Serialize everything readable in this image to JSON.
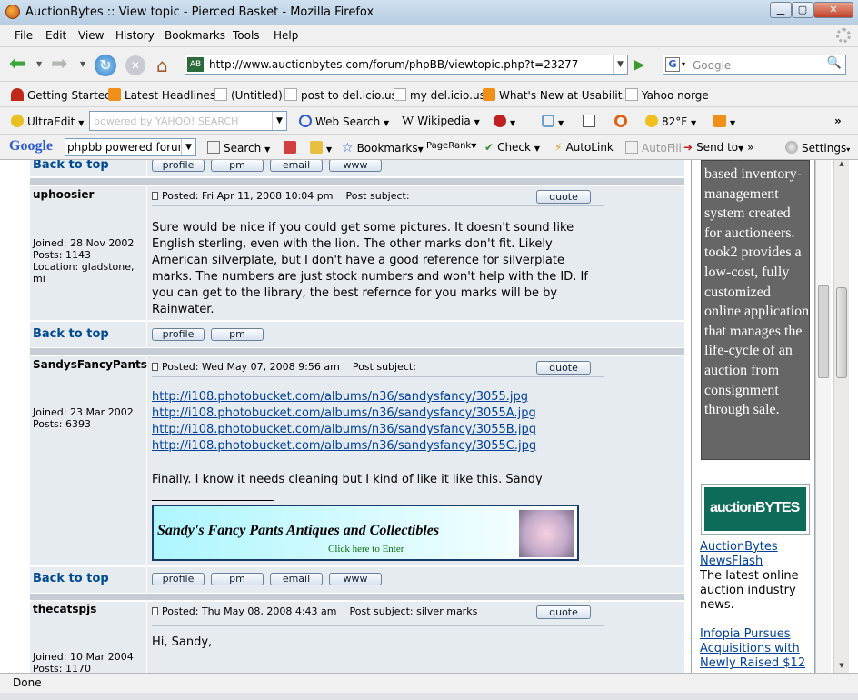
{
  "window": {
    "title": "AuctionBytes :: View topic - Pierced Basket - Mozilla Firefox"
  },
  "menu": [
    "File",
    "Edit",
    "View",
    "History",
    "Bookmarks",
    "Tools",
    "Help"
  ],
  "url": "http://www.auctionbytes.com/forum/phpBB/viewtopic.php?t=23277",
  "search": {
    "placeholder": "Google"
  },
  "bookmarks": [
    "Getting Started",
    "Latest Headlines",
    "(Untitled)",
    "post to del.icio.us",
    "my del.icio.us",
    "What's New at Usabilit...",
    "Yahoo norge"
  ],
  "toolbar": {
    "ultraedit": "UltraEdit",
    "yahoo_placeholder": "powered by YAHOO! SEARCH",
    "websearch": "Web Search",
    "wikipedia": "Wikipedia",
    "temp": "82°F"
  },
  "google_bar": {
    "logo": "Google",
    "query": "phpbb powered forum",
    "search": "Search",
    "bookmarks": "Bookmarks",
    "pagerank": "PageRank",
    "check": "Check",
    "autolink": "AutoLink",
    "autofill": "AutoFill",
    "sendto": "Send to",
    "settings": "Settings"
  },
  "forum": {
    "back_to_top": "Back to top",
    "btn_profile": "profile",
    "btn_pm": "pm",
    "btn_email": "email",
    "btn_www": "www",
    "btn_quote": "quote",
    "posts": [
      {
        "author": "uphoosier",
        "joined": "Joined: 28 Nov 2002",
        "posts": "Posts: 1143",
        "location": "Location: gladstone, mi",
        "posted": "Posted: Fri Apr 11, 2008 10:04 pm",
        "subject": "Post subject:",
        "body": "Sure would be nice if you could get some pictures. It doesn't sound like English sterling, even with the lion. The other marks don't fit. Likely American silverplate, but I don't have a good reference for silverplate marks. The numbers are just stock numbers and won't help with the ID. If you can get to the library, the best refernce for you marks will be by Rainwater."
      },
      {
        "author": "SandysFancyPants",
        "joined": "Joined: 23 Mar 2002",
        "posts": "Posts: 6393",
        "posted": "Posted: Wed May 07, 2008 9:56 am",
        "subject": "Post subject:",
        "links": [
          "http://i108.photobucket.com/albums/n36/sandysfancy/3055.jpg",
          "http://i108.photobucket.com/albums/n36/sandysfancy/3055A.jpg",
          "http://i108.photobucket.com/albums/n36/sandysfancy/3055B.jpg",
          "http://i108.photobucket.com/albums/n36/sandysfancy/3055C.jpg"
        ],
        "body": "Finally. I know it needs cleaning but I kind of like it like this. Sandy",
        "banner_title": "Sandy's Fancy Pants Antiques and Collectibles",
        "banner_sub": "Click here to Enter"
      },
      {
        "author": "thecatspjs",
        "joined": "Joined: 10 Mar 2004",
        "posts": "Posts: 1170",
        "posted": "Posted: Thu May 08, 2008 4:43 am",
        "subject": "Post subject: silver marks",
        "body": "Hi, Sandy,"
      }
    ]
  },
  "sidebar": {
    "ad_text": "based inventory-management system created for auctioneers. took2 provides a low-cost, fully customized online application that manages the life-cycle of an auction from consignment through sale.",
    "logo_text": "auctionBYTES",
    "newsflash_link": "AuctionBytes NewsFlash",
    "newsflash_text": "The latest online auction industry news.",
    "story_link": "Infopia Pursues Acquisitions with Newly Raised $12"
  },
  "status": "Done"
}
